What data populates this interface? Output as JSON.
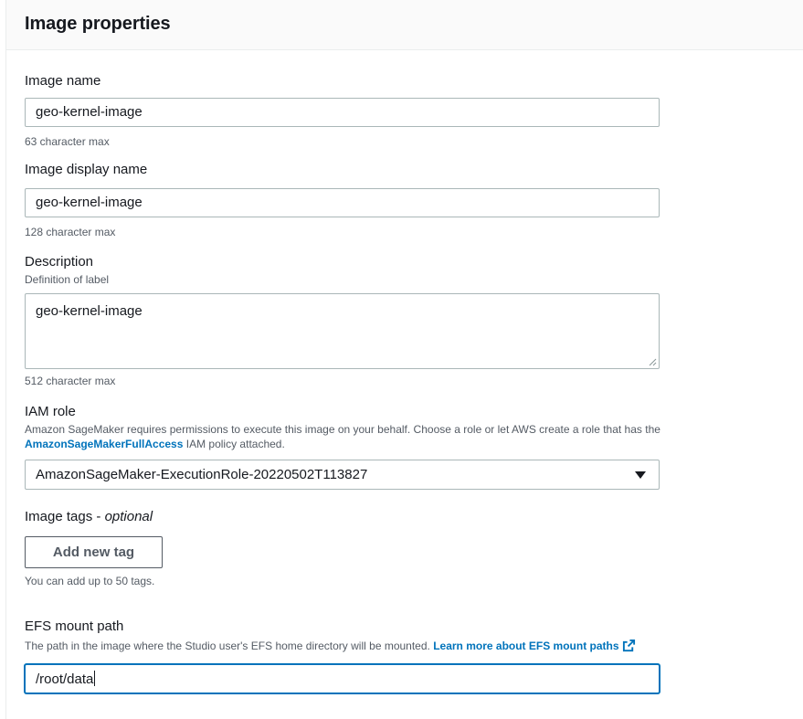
{
  "panel": {
    "title": "Image properties"
  },
  "image_name": {
    "label": "Image name",
    "value": "geo-kernel-image",
    "hint": "63 character max"
  },
  "display_name": {
    "label": "Image display name",
    "value": "geo-kernel-image",
    "hint": "128 character max"
  },
  "description": {
    "label": "Description",
    "sublabel": "Definition of label",
    "value": "geo-kernel-image",
    "hint": "512 character max"
  },
  "iam_role": {
    "label": "IAM role",
    "desc_before": "Amazon SageMaker requires permissions to execute this image on your behalf. Choose a role or let AWS create a role that has the",
    "policy_link": "AmazonSageMakerFullAccess",
    "desc_after": "IAM policy attached.",
    "selected": "AmazonSageMaker-ExecutionRole-20220502T113827"
  },
  "tags": {
    "label": "Image tags",
    "label_sep": " - ",
    "optional": "optional",
    "add_button": "Add new tag",
    "hint": "You can add up to 50 tags."
  },
  "efs": {
    "label": "EFS mount path",
    "desc": "The path in the image where the Studio user's EFS home directory will be mounted.",
    "learn_more": "Learn more about EFS mount paths",
    "value": "/root/data"
  },
  "icons": {
    "caret": "caret-down-icon",
    "external_link": "external-link-icon",
    "resize": "resize-grip-icon"
  },
  "colors": {
    "link": "#0073bb",
    "focus": "#0073bb",
    "text": "#16191f",
    "muted": "#545b64",
    "border": "#aab7b8"
  }
}
